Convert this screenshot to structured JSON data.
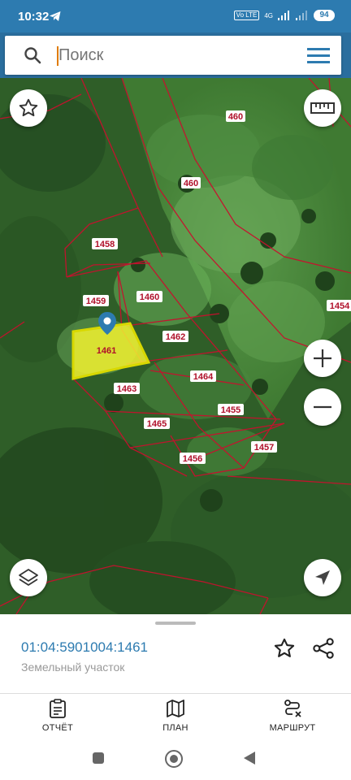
{
  "status": {
    "time": "10:32",
    "network": "4G",
    "volte": "Vo LTE",
    "battery": "94"
  },
  "search": {
    "placeholder": "Поиск"
  },
  "map": {
    "parcels": [
      {
        "id": "460a",
        "label": "460"
      },
      {
        "id": "460b",
        "label": "460"
      },
      {
        "id": "1458",
        "label": "1458"
      },
      {
        "id": "1459",
        "label": "1459"
      },
      {
        "id": "1460",
        "label": "1460"
      },
      {
        "id": "1454",
        "label": "1454"
      },
      {
        "id": "1461",
        "label": "1461"
      },
      {
        "id": "1462",
        "label": "1462"
      },
      {
        "id": "1463",
        "label": "1463"
      },
      {
        "id": "1464",
        "label": "1464"
      },
      {
        "id": "1455",
        "label": "1455"
      },
      {
        "id": "1465",
        "label": "1465"
      },
      {
        "id": "1457",
        "label": "1457"
      },
      {
        "id": "1456",
        "label": "1456"
      }
    ],
    "colors": {
      "boundary": "#c8102e",
      "selected_fill": "#f2f230",
      "selected_stroke": "#d8d800",
      "pin": "#2d7bb0"
    }
  },
  "sheet": {
    "cadastral_number": "01:04:5901004:1461",
    "land_type": "Земельный участок"
  },
  "nav": {
    "report": "ОТЧЁТ",
    "plan": "ПЛАН",
    "route": "МАРШРУТ"
  }
}
